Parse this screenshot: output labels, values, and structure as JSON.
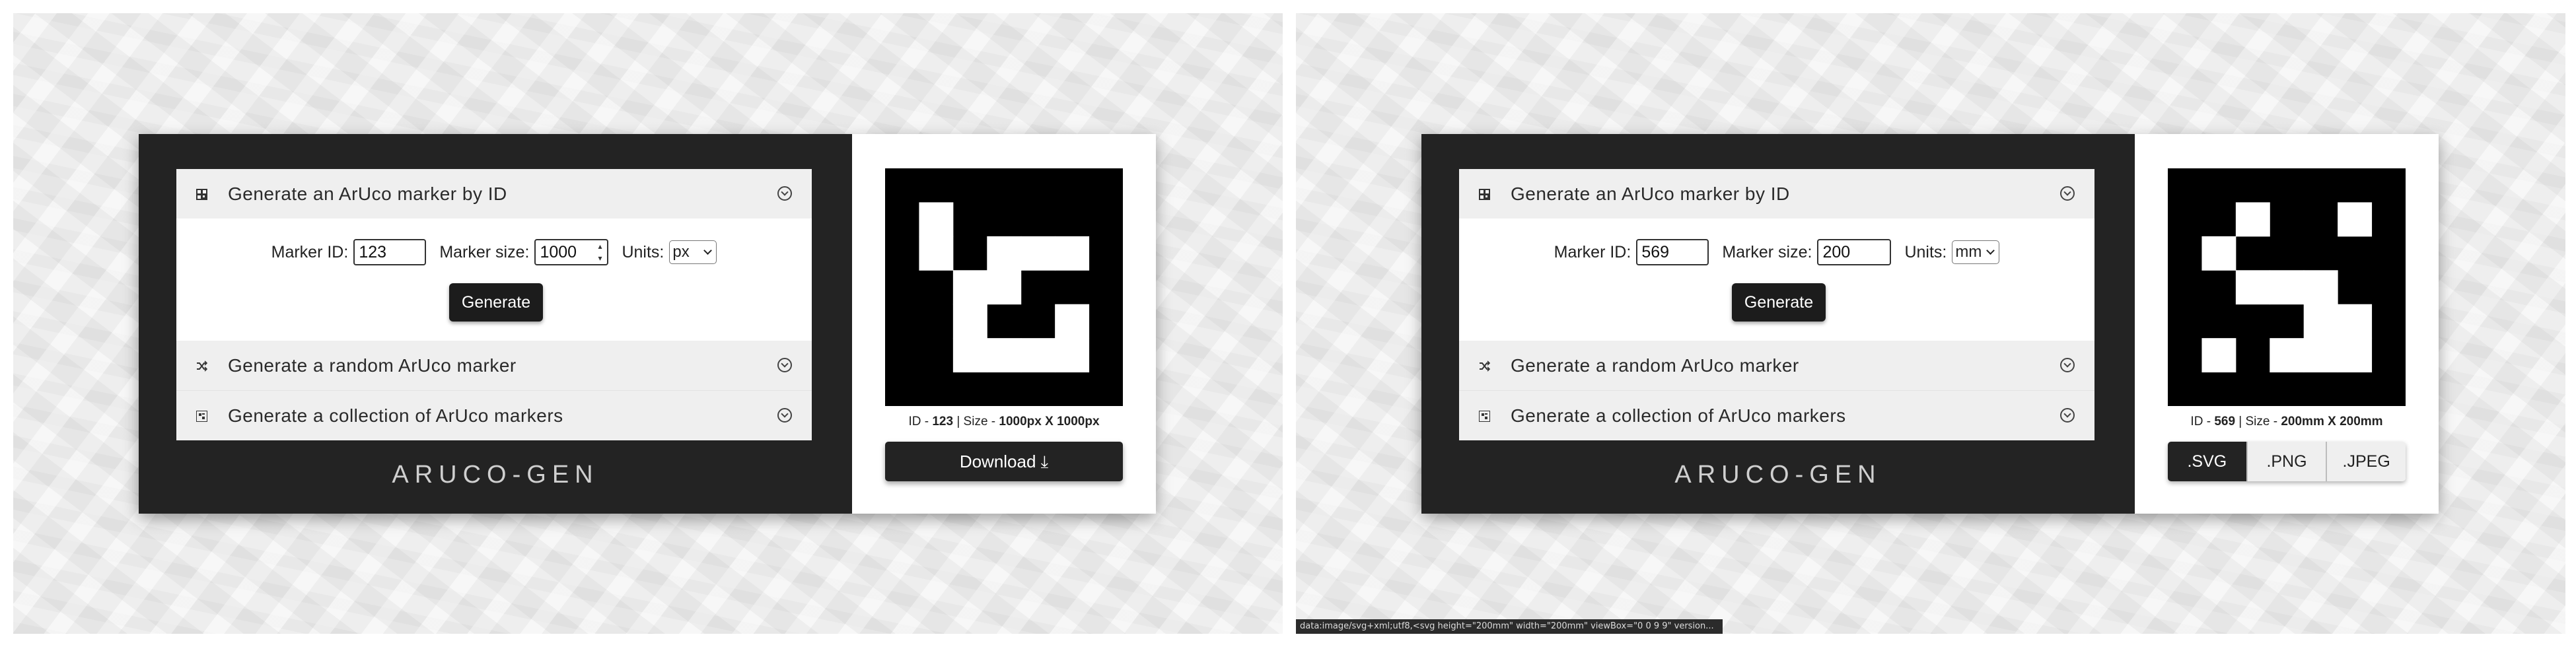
{
  "panels": [
    {
      "accordion": {
        "section1_title": "Generate an ArUco marker by ID",
        "marker_id_label": "Marker ID:",
        "marker_id_value": "123",
        "marker_size_label": "Marker size:",
        "marker_size_value": "1000",
        "units_label": "Units:",
        "units_value": "px",
        "generate_label": "Generate",
        "section2_title": "Generate a random ArUco marker",
        "section3_title": "Generate a collection of ArUco markers"
      },
      "logo": "ARUCO-GEN",
      "marker": {
        "grid": [
          [
            1,
            1,
            1,
            1,
            1,
            1,
            1
          ],
          [
            1,
            0,
            1,
            1,
            1,
            1,
            1
          ],
          [
            1,
            0,
            1,
            0,
            0,
            0,
            1
          ],
          [
            1,
            1,
            0,
            0,
            1,
            1,
            1
          ],
          [
            1,
            1,
            0,
            1,
            1,
            0,
            1
          ],
          [
            1,
            1,
            0,
            0,
            0,
            0,
            1
          ],
          [
            1,
            1,
            1,
            1,
            1,
            1,
            1
          ]
        ],
        "id_prefix": "ID - ",
        "id_value": "123",
        "size_sep": " | Size - ",
        "size_value": "1000px X 1000px"
      },
      "download_label": "Download ⤓"
    },
    {
      "accordion": {
        "section1_title": "Generate an ArUco marker by ID",
        "marker_id_label": "Marker ID:",
        "marker_id_value": "569",
        "marker_size_label": "Marker size:",
        "marker_size_value": "200",
        "units_label": "Units:",
        "units_value": "mm",
        "generate_label": "Generate",
        "section2_title": "Generate a random ArUco marker",
        "section3_title": "Generate a collection of ArUco markers"
      },
      "logo": "ARUCO-GEN",
      "marker": {
        "grid": [
          [
            1,
            1,
            1,
            1,
            1,
            1,
            1
          ],
          [
            1,
            1,
            0,
            1,
            1,
            0,
            1
          ],
          [
            1,
            0,
            1,
            1,
            1,
            1,
            1
          ],
          [
            1,
            1,
            0,
            0,
            0,
            1,
            1
          ],
          [
            1,
            1,
            1,
            1,
            0,
            0,
            1
          ],
          [
            1,
            0,
            1,
            0,
            0,
            0,
            1
          ],
          [
            1,
            1,
            1,
            1,
            1,
            1,
            1
          ]
        ],
        "id_prefix": "ID - ",
        "id_value": "569",
        "size_sep": " | Size - ",
        "size_value": "200mm X 200mm"
      },
      "formats": [
        ".SVG",
        ".PNG",
        ".JPEG"
      ],
      "status_bar": "data:image/svg+xml;utf8,<svg height=\"200mm\" width=\"200mm\" viewBox=\"0 0 9 9\" version..."
    }
  ],
  "colors": {
    "card_dark": "#232323",
    "button_dark": "#1c1c1c",
    "accordion_header": "#efefef",
    "background": "#eeeeee"
  },
  "icons": [
    "qr-code-icon",
    "shuffle-icon",
    "grid-collection-icon",
    "chevron-circle-icon",
    "download-arrow-icon"
  ]
}
